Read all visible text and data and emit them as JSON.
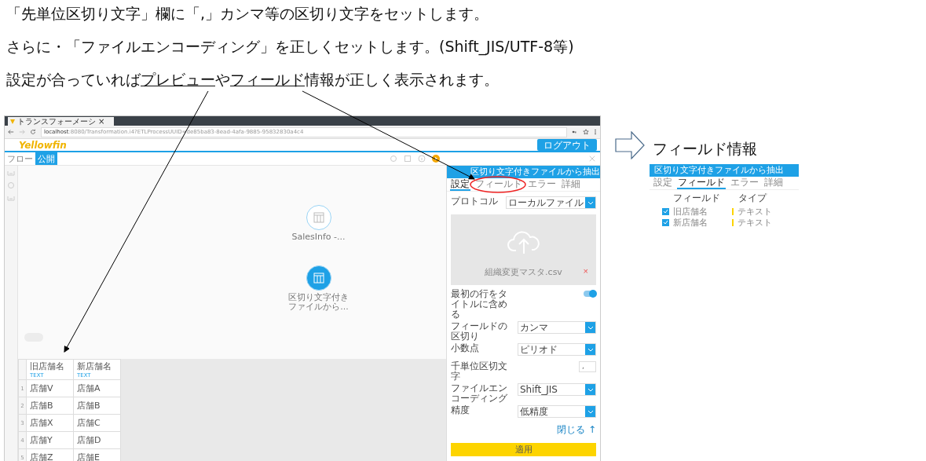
{
  "instructions": [
    {
      "parts": [
        {
          "text": "「先単位区切り文字」欄に「,」カンマ等の区切り文字をセットします。",
          "underline": false
        }
      ]
    },
    {
      "parts": [
        {
          "text": "さらに・「ファイルエンコーディング」を正しくセットします。(Shift_JIS/UTF-8等)",
          "underline": false
        }
      ]
    },
    {
      "parts": [
        {
          "text": "設定が合っていれば",
          "underline": false
        },
        {
          "text": "プレビュー",
          "underline": true
        },
        {
          "text": "や",
          "underline": false
        },
        {
          "text": "フィールド",
          "underline": true
        },
        {
          "text": "情報が正しく表示されます。",
          "underline": false
        }
      ]
    }
  ],
  "browser": {
    "tab_title": "トランスフォーメーシ",
    "tab_close": "×",
    "url_host": "localhost",
    "url_path": ":8080/Transformation.i4?ETLProcessUUID=de85ba83-8ead-4afa-9885-95832830a4c4"
  },
  "app": {
    "logo": "Yellowfin",
    "logout": "ログアウト",
    "toolbar_tabs": [
      {
        "label": "フロー",
        "selected": false
      },
      {
        "label": "公開",
        "selected": true
      }
    ]
  },
  "canvas": {
    "nodes": [
      {
        "label": "SalesInfo -...",
        "selected": false
      },
      {
        "label": "区切り文字付きファイルから...",
        "selected": true
      }
    ]
  },
  "preview": {
    "columns": [
      {
        "name": "旧店舗名",
        "type": "TEXT"
      },
      {
        "name": "新店舗名",
        "type": "TEXT"
      }
    ],
    "rows": [
      {
        "number": "1",
        "cells": [
          "店舗V",
          "店舗A"
        ]
      },
      {
        "number": "2",
        "cells": [
          "店舗B",
          "店舗B"
        ]
      },
      {
        "number": "3",
        "cells": [
          "店舗X",
          "店舗C"
        ]
      },
      {
        "number": "4",
        "cells": [
          "店舗Y",
          "店舗D"
        ]
      },
      {
        "number": "5",
        "cells": [
          "店舗Z",
          "店舗E"
        ]
      }
    ]
  },
  "panel": {
    "title": "区切り文字付きファイルから抽出",
    "tabs": [
      {
        "label": "設定",
        "selected": true
      },
      {
        "label": "フィールド",
        "selected": false
      },
      {
        "label": "エラー",
        "selected": false
      },
      {
        "label": "詳細",
        "selected": false
      }
    ],
    "protocol": {
      "label": "プロトコル",
      "value": "ローカルファイル"
    },
    "upload": {
      "file": "組織変更マスタ.csv",
      "remove": "×"
    },
    "settings": [
      {
        "kind": "toggle",
        "label": "最初の行をタイトルに含める",
        "on": true
      },
      {
        "kind": "select",
        "label": "フィールドの区切り",
        "value": "カンマ"
      },
      {
        "kind": "select",
        "label": "小数点",
        "value": "ピリオド"
      },
      {
        "kind": "text",
        "label": "千単位区切文字",
        "value": ","
      },
      {
        "kind": "select",
        "label": "ファイルエンコーディング",
        "value": "Shift_JIS"
      },
      {
        "kind": "select",
        "label": "精度",
        "value": "低精度"
      }
    ],
    "close_link": "閉じる ↑",
    "apply": "適用"
  },
  "field_info": {
    "title": "フィールド情報",
    "panel_title": "区切り文字付きファイルから抽出",
    "tabs": [
      {
        "label": "設定",
        "selected": false
      },
      {
        "label": "フィールド",
        "selected": true
      },
      {
        "label": "エラー",
        "selected": false
      },
      {
        "label": "詳細",
        "selected": false
      }
    ],
    "columns": [
      "フィールド",
      "タイプ"
    ],
    "rows": [
      {
        "name": "旧店舗名",
        "type": "テキスト",
        "checked": true
      },
      {
        "name": "新店舗名",
        "type": "テキスト",
        "checked": true
      }
    ]
  }
}
